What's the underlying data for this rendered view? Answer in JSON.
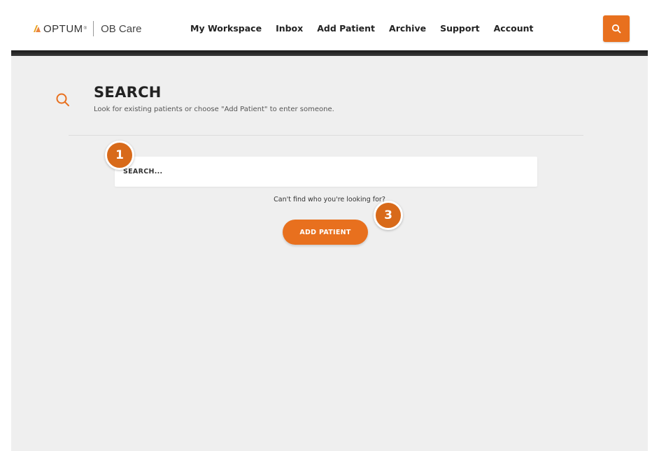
{
  "header": {
    "brand": "OPTUM",
    "brand_tm": "®",
    "product": "OB Care",
    "nav": [
      {
        "label": "My Workspace"
      },
      {
        "label": "Inbox"
      },
      {
        "label": "Add Patient"
      },
      {
        "label": "Archive"
      },
      {
        "label": "Support"
      },
      {
        "label": "Account"
      }
    ]
  },
  "page": {
    "title": "SEARCH",
    "subtitle": "Look for existing patients or choose \"Add Patient\" to enter someone."
  },
  "search": {
    "placeholder": "SEARCH..."
  },
  "hint": "Can't find who you're looking for?",
  "add_button_label": "ADD PATIENT",
  "steps": {
    "one": "1",
    "three": "3"
  },
  "colors": {
    "accent": "#e8701e",
    "step_badge": "#d86a1a",
    "background": "#efefef",
    "header_bar": "#1a1a1a"
  }
}
